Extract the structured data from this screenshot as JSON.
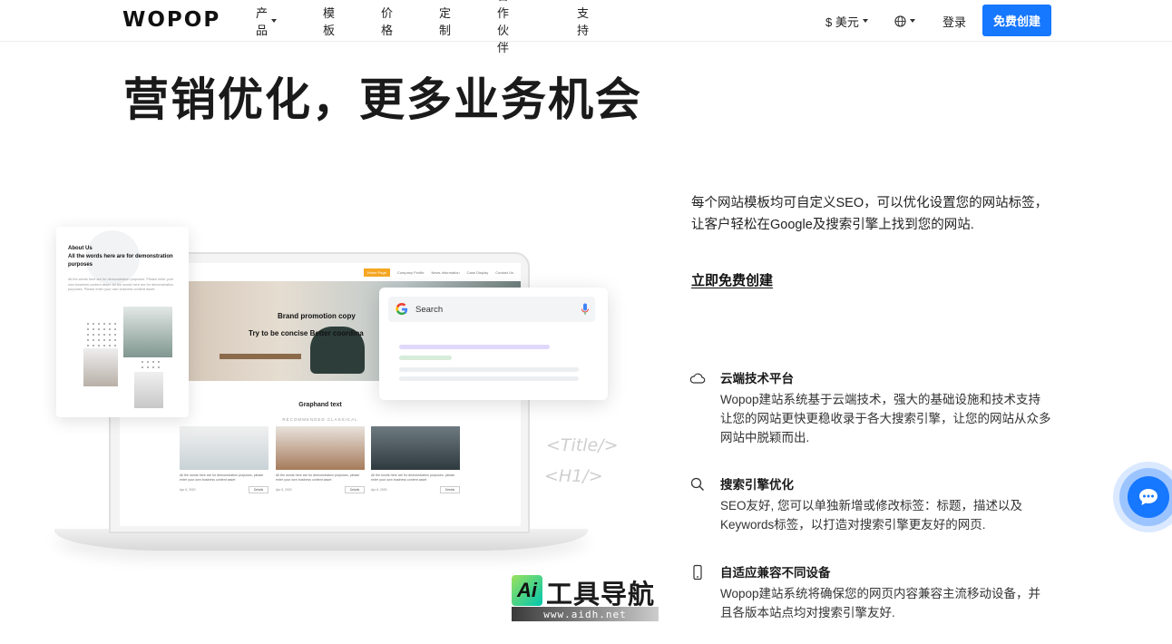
{
  "header": {
    "logo": "WOPOP",
    "nav": [
      {
        "label": "产品",
        "has_caret": true
      },
      {
        "label": "模板",
        "has_caret": false
      },
      {
        "label": "价格",
        "has_caret": false
      },
      {
        "label": "定制",
        "has_caret": false
      },
      {
        "label": "合作伙伴",
        "has_caret": false
      },
      {
        "label": "支持",
        "has_caret": false
      }
    ],
    "currency": "$ 美元",
    "login": "登录",
    "signup": "免费创建",
    "globe_icon": "globe-icon"
  },
  "hero": {
    "title": "营销优化，更多业务机会"
  },
  "intro": {
    "text": "每个网站模板均可自定义SEO，可以优化设置您的网站标签，让客户轻松在Google及搜索引擎上找到您的网站.",
    "cta": "立即免费创建"
  },
  "features": [
    {
      "icon": "cloud-icon",
      "title": "云端技术平台",
      "desc": "Wopop建站系统基于云端技术，强大的基础设施和技术支持让您的网站更快更稳收录于各大搜索引擎，让您的网站从众多网站中脱颖而出."
    },
    {
      "icon": "search-icon",
      "title": "搜索引擎优化",
      "desc": "SEO友好, 您可以单独新增或修改标签：标题，描述以及Keywords标签，以打造对搜索引擎更友好的网页."
    },
    {
      "icon": "mobile-device-icon",
      "title": "自适应兼容不同设备",
      "desc": "Wopop建站系统将确保您的网页内容兼容主流移动设备，并且各版本站点均对搜索引擎友好."
    }
  ],
  "mockup": {
    "about_title": "About Us\nAll the words here are for demonstration purposes",
    "about_body": "All the words here are for demonstration purposes. Please enter your own business content asset. All the words here are for demonstration purposes. Please enter your own business content asset.",
    "nav_items": [
      "Home Page",
      "Company Profile",
      "News Information",
      "Case Display",
      "Contact Us"
    ],
    "banner_line1": "Brand promotion copy",
    "banner_line2": "Try to be concise Better coordina",
    "section_title": "Graphand text",
    "section_subtitle": "RECOMMENDED CLASSICAL",
    "cards": [
      {
        "text": "All the words here are for demonstration purposes, please enter your own business content asset",
        "date": "Apr 6, 2020",
        "button": "Details"
      },
      {
        "text": "All the words here are for demonstration purposes, please enter your own business content asset",
        "date": "Apr 6, 2020",
        "button": "Details"
      },
      {
        "text": "All the words here are for demonstration purposes, please enter your own business content asset",
        "date": "Apr 6, 2020",
        "button": "Details"
      }
    ],
    "search_label": "Search",
    "tag_title": "<Title/>",
    "tag_h1": "<H1/>"
  },
  "watermark": {
    "badge": "Ai",
    "text": "工具导航",
    "url": "www.aidh.net"
  },
  "colors": {
    "primary": "#1677ff",
    "text": "#1f1f1f"
  }
}
